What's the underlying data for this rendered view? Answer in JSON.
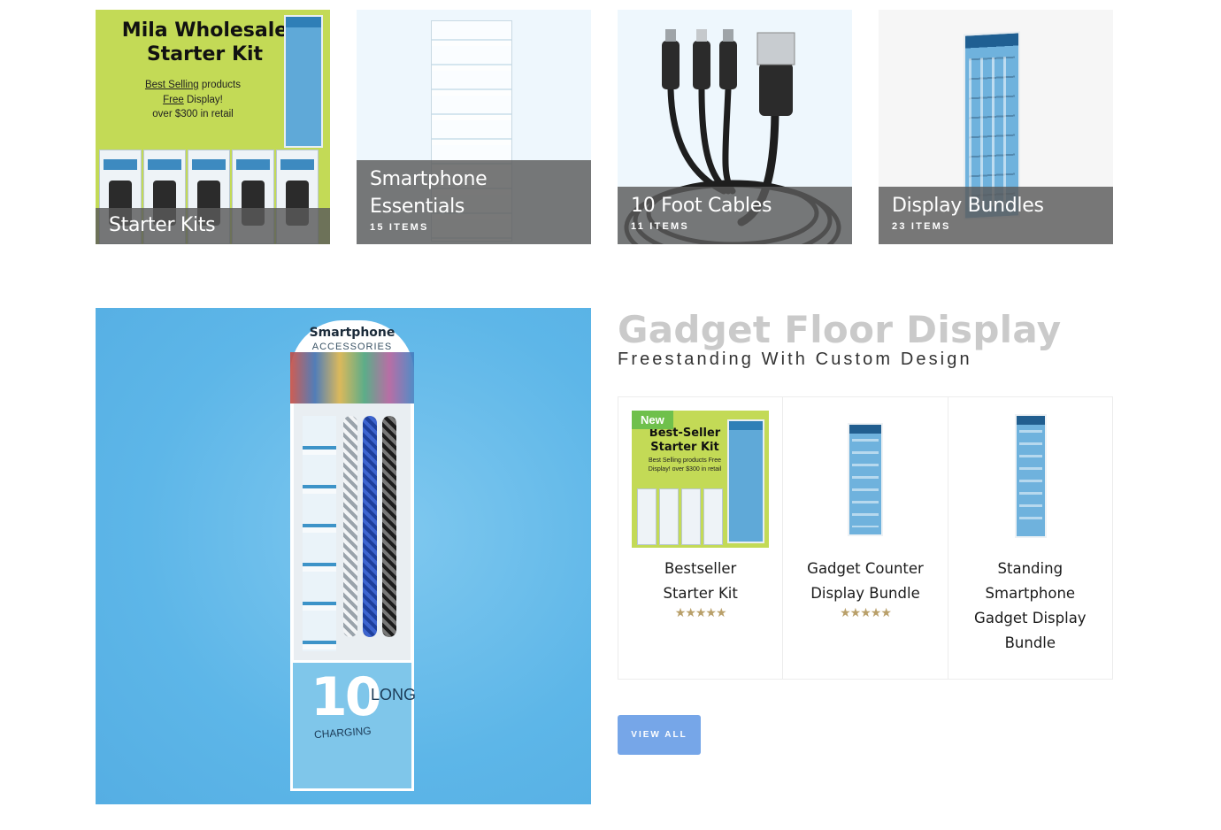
{
  "categories": [
    {
      "title": "Starter Kits",
      "count": "",
      "promo": {
        "heading": "Mila Wholesale Starter Kit",
        "line1_underlined": "Best Selling",
        "line1_rest": " products",
        "line2_underlined": "Free",
        "line2_rest": " Display!",
        "line3": "over $300 in retail"
      }
    },
    {
      "title": "Smartphone Essentials",
      "count": "15 ITEMS"
    },
    {
      "title": "10 Foot Cables",
      "count": "11 ITEMS"
    },
    {
      "title": "Display Bundles",
      "count": "23 ITEMS"
    }
  ],
  "hero": {
    "display_title": "Smartphone",
    "display_subtitle": "ACCESSORIES",
    "big_number": "10",
    "length_word": "LONG",
    "charging_word": "CHARGING"
  },
  "section": {
    "title": "Gadget Floor Display",
    "subtitle": "Freestanding With Custom Design"
  },
  "products": [
    {
      "name": "Bestseller Starter Kit",
      "badge": "New",
      "rating": "★★★★★",
      "image_heading": "Best-Seller Starter Kit",
      "image_text": "Best Selling products Free Display! over $300 in retail"
    },
    {
      "name": "Gadget Counter Display Bundle",
      "rating": "★★★★★"
    },
    {
      "name": "Standing Smartphone Gadget Display Bundle"
    }
  ],
  "view_all_label": "VIEW ALL",
  "colors": {
    "kit_green": "#c3da56",
    "hero_blue": "#5db6e8",
    "button_blue": "#76a6e8",
    "badge_green": "#6fc04c",
    "star_gold": "#b9a06a"
  }
}
